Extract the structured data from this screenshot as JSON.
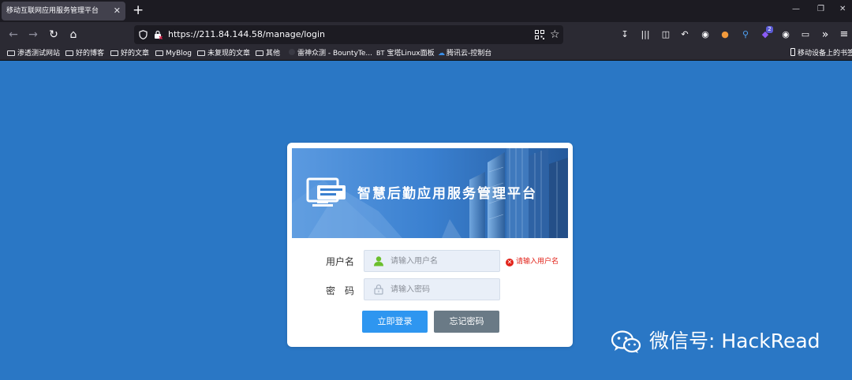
{
  "browser": {
    "tab_title": "移动互联网应用服务管理平台",
    "tab_close": "✕",
    "new_tab": "+",
    "url": "https://211.84.144.58/manage/login",
    "extension_badge": "2"
  },
  "bookmarks": [
    {
      "label": "渗透测试网站",
      "icon": "folder-icon"
    },
    {
      "label": "好的博客",
      "icon": "folder-icon"
    },
    {
      "label": "好的文章",
      "icon": "folder-icon"
    },
    {
      "label": "MyBlog",
      "icon": "folder-icon"
    },
    {
      "label": "未复现的文章",
      "icon": "folder-icon"
    },
    {
      "label": "其他",
      "icon": "folder-icon"
    },
    {
      "label": "雷神众测 - BountyTe...",
      "icon": "bountyteam-icon"
    },
    {
      "label": "宝塔Linux面板",
      "icon": "bt-icon",
      "prefix": "BT"
    },
    {
      "label": "腾讯云-控制台",
      "icon": "tencent-cloud-icon"
    },
    {
      "label": "移动设备上的书签",
      "icon": "mobile-device-icon"
    }
  ],
  "login": {
    "banner_title": "智慧后勤应用服务管理平台",
    "username_label": "用户名",
    "username_placeholder": "请输入用户名",
    "username_value": "",
    "username_error": "请输入用户名",
    "password_label": "密　码",
    "password_placeholder": "请输入密码",
    "password_value": "",
    "login_button": "立即登录",
    "forgot_button": "忘记密码"
  },
  "watermark": {
    "text": "微信号: HackRead"
  },
  "colors": {
    "page_background": "#2a77c5",
    "login_button": "#2e96f0",
    "forgot_button": "#6a7a86",
    "error": "#e2231a"
  }
}
